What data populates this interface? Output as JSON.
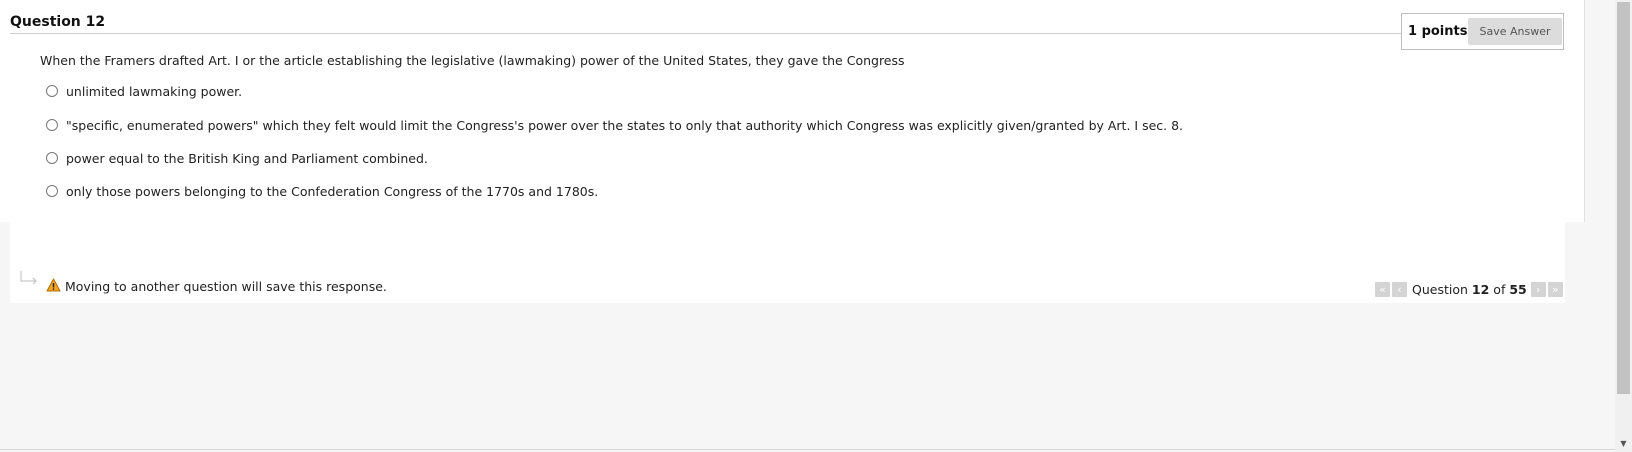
{
  "question": {
    "title": "Question 12",
    "points_label": "1 points",
    "save_label": "Save Answer",
    "text": "When the Framers drafted Art. I or the article establishing the legislative (lawmaking) power of the United States, they gave the Congress",
    "options": [
      {
        "label": "unlimited lawmaking power."
      },
      {
        "label": "\"specific, enumerated powers\" which they felt would limit the Congress's power over the states to only that authority which Congress was explicitly given/granted by Art. I sec. 8."
      },
      {
        "label": "power equal to the British King and Parliament combined."
      },
      {
        "label": "only those powers belonging to the Confederation Congress of the 1770s and 1780s."
      }
    ]
  },
  "footer": {
    "warning_text": "Moving to another question will save this response.",
    "nav": {
      "prefix": "Question",
      "current": "12",
      "of": "of",
      "total": "55"
    }
  },
  "icons": {
    "warning": "warning-triangle-icon",
    "arrow": "return-arrow-icon",
    "first": "double-chevron-left-icon",
    "prev": "chevron-left-icon",
    "next": "chevron-right-icon",
    "last": "double-chevron-right-icon"
  },
  "colors": {
    "warning_fill": "#f5a623",
    "nav_button": "#d4d4d4",
    "save_button": "#dcdcdc"
  }
}
